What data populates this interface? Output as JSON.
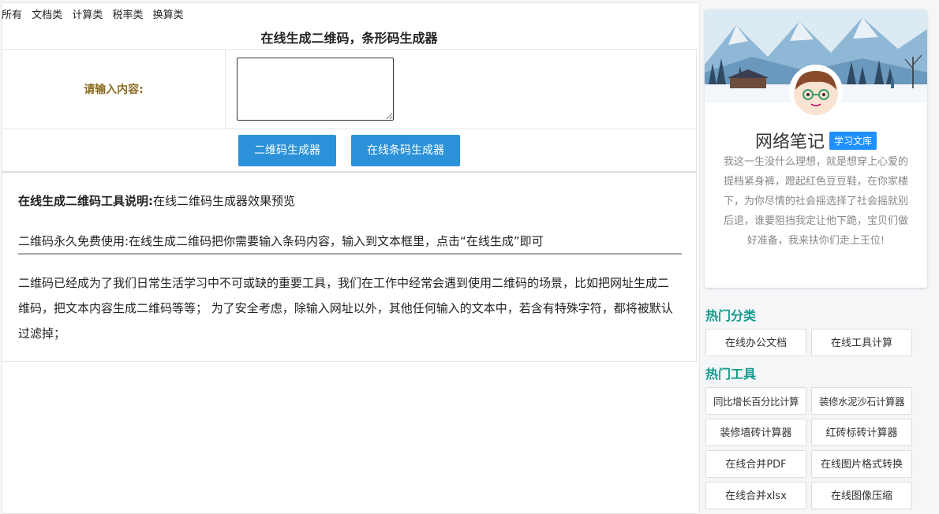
{
  "nav": {
    "items": [
      "所有",
      "文档类",
      "计算类",
      "税率类",
      "换算类"
    ]
  },
  "page": {
    "title": "在线生成二维码，条形码生成器"
  },
  "form": {
    "label": "请输入内容:",
    "textarea_value": "",
    "buttons": {
      "qrcode": "二维码生成器",
      "barcode": "在线条码生成器"
    }
  },
  "description": {
    "heading": "在线生成二维码工具说明:",
    "heading_rest": "在线二维码生成器效果预览",
    "line2": "二维码永久免费使用:在线生成二维码把你需要输入条码内容，输入到文本框里，点击“在线生成”即可",
    "line3": "二维码已经成为了我们日常生活学习中不可或缺的重要工具，我们在工作中经常会遇到使用二维码的场景，比如把网址生成二维码，把文本内容生成二维码等等； 为了安全考虑，除输入网址以外，其他任何输入的文本中，若含有特殊字符，都将被默认过滤掉；"
  },
  "sidebar": {
    "name": "网络笔记",
    "tag": "学习文库",
    "bio": "我这一生没什么理想，就是想穿上心爱的提档紧身裤，蹬起红色豆豆鞋，在你家楼下，为你尽情的社会摇选择了社会摇就别后退，谁要阻挡我定让他下跪，宝贝们做好准备，我来扶你们走上王位!",
    "hot_categories_title": "热门分类",
    "hot_categories": [
      "在线办公文档",
      "在线工具计算"
    ],
    "hot_tools_title": "热门工具",
    "hot_tools": [
      "同比增长百分比计算",
      "装修水泥沙石计算器",
      "装修墙砖计算器",
      "红砖标砖计算器",
      "在线合并PDF",
      "在线图片格式转换",
      "在线合并xlsx",
      "在线图像压缩"
    ]
  },
  "colors": {
    "button": "#2b92d9",
    "label": "#8a6a1f",
    "section": "#159a8c",
    "tag": "#1e90ff"
  }
}
